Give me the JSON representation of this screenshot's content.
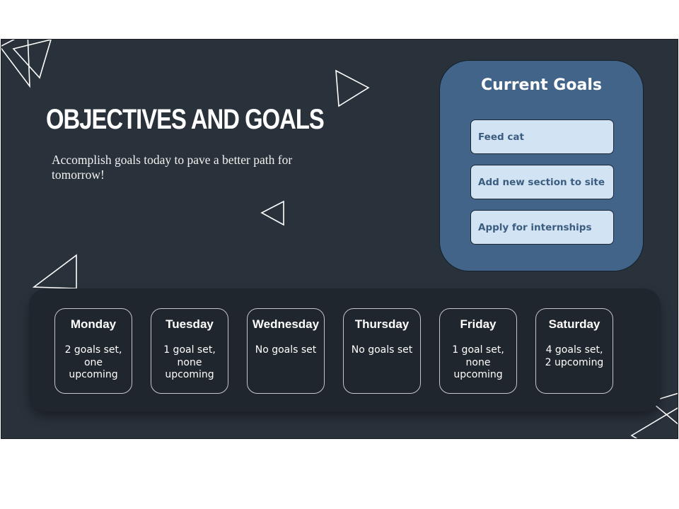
{
  "slide": {
    "title": "OBJECTIVES AND GOALS",
    "subtitle": "Accomplish goals today to pave a better path for tomorrow!"
  },
  "current_goals": {
    "title": "Current Goals",
    "items": [
      {
        "label": "Feed cat"
      },
      {
        "label": "Add new section to site"
      },
      {
        "label": "Apply for internships"
      }
    ]
  },
  "week": {
    "days": [
      {
        "name": "Monday",
        "status": "2 goals set, one upcoming"
      },
      {
        "name": "Tuesday",
        "status": "1 goal set, none upcoming"
      },
      {
        "name": "Wednesday",
        "status": "No goals set"
      },
      {
        "name": "Thursday",
        "status": "No goals set"
      },
      {
        "name": "Friday",
        "status": "1 goal set, none upcoming"
      },
      {
        "name": "Saturday",
        "status": "4 goals set, 2 upcoming"
      }
    ]
  },
  "colors": {
    "background": "#29313a",
    "panel_accent": "#416488",
    "goal_item_bg": "#d2e3f4",
    "goal_item_text": "#3b5d80",
    "week_panel_bg": "#20262d"
  },
  "icons": [
    "triangle-outline-icon"
  ]
}
